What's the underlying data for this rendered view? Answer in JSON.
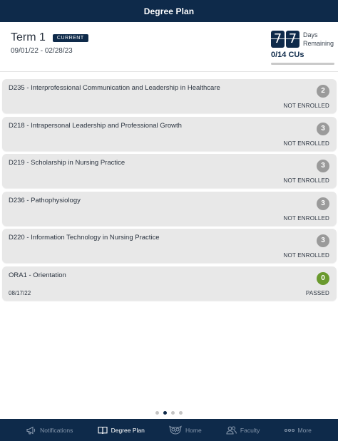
{
  "header": {
    "title": "Degree Plan"
  },
  "term": {
    "title": "Term 1",
    "badge": "CURRENT",
    "dates": "09/01/22 - 02/28/23",
    "days_digits": [
      "7",
      "7"
    ],
    "days_label_line1": "Days",
    "days_label_line2": "Remaining",
    "cus_text": "0/14 CUs",
    "cu_progress_fraction": 0
  },
  "courses": [
    {
      "title": "D235 - Interprofessional Communication and Leadership in Healthcare",
      "cu": "2",
      "status": "NOT ENROLLED",
      "date": ""
    },
    {
      "title": "D218 - Intrapersonal Leadership and Professional Growth",
      "cu": "3",
      "status": "NOT ENROLLED",
      "date": ""
    },
    {
      "title": "D219 - Scholarship in Nursing Practice",
      "cu": "3",
      "status": "NOT ENROLLED",
      "date": ""
    },
    {
      "title": "D236 - Pathophysiology",
      "cu": "3",
      "status": "NOT ENROLLED",
      "date": ""
    },
    {
      "title": "D220 - Information Technology in Nursing Practice",
      "cu": "3",
      "status": "NOT ENROLLED",
      "date": ""
    },
    {
      "title": "ORA1 - Orientation",
      "cu": "0",
      "status": "PASSED",
      "date": "08/17/22"
    }
  ],
  "pager": {
    "count": 4,
    "active_index": 1
  },
  "tabs": [
    {
      "label": "Notifications",
      "icon": "megaphone-icon",
      "active": false
    },
    {
      "label": "Degree Plan",
      "icon": "open-book-icon",
      "active": true
    },
    {
      "label": "Home",
      "icon": "owl-icon",
      "active": false
    },
    {
      "label": "Faculty",
      "icon": "people-icon",
      "active": false
    },
    {
      "label": "More",
      "icon": "more-dots-icon",
      "active": false
    }
  ],
  "colors": {
    "navy": "#0e2a4a",
    "card": "#e8e8e8",
    "cu_grey": "#9a9a9a",
    "passed_green": "#6a9a2e"
  }
}
